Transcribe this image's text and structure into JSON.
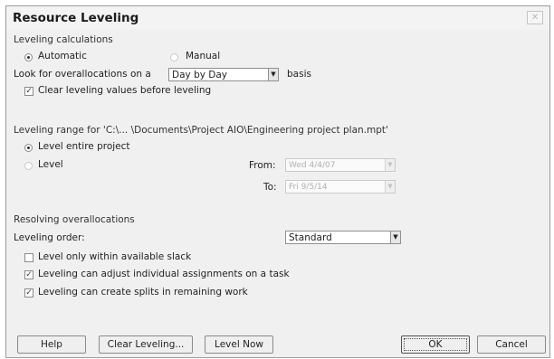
{
  "dialog": {
    "title": "Resource Leveling",
    "close_symbol": "✕"
  },
  "leveling_calculations": {
    "section_label": "Leveling calculations",
    "automatic_label": "Automatic",
    "automatic_selected": true,
    "manual_label": "Manual",
    "look_for_label": "Look for overallocations on a",
    "basis_value": "Day by Day",
    "basis_suffix": "basis",
    "clear_values_label": "Clear leveling values before leveling",
    "clear_values_checked": true
  },
  "leveling_range": {
    "section_label": "Leveling range for 'C:\\... \\Documents\\Project AIO\\Engineering project plan.mpt'",
    "level_entire_label": "Level entire project",
    "level_entire_selected": true,
    "level_label": "Level",
    "from_label": "From:",
    "from_value": "Wed 4/4/07",
    "to_label": "To:",
    "to_value": "Fri 9/5/14"
  },
  "resolving": {
    "section_label": "Resolving overallocations",
    "order_label": "Leveling order:",
    "order_value": "Standard",
    "within_slack_label": "Level only within available slack",
    "within_slack_checked": false,
    "adjust_assignments_label": "Leveling can adjust individual assignments on a task",
    "adjust_assignments_checked": true,
    "create_splits_label": "Leveling can create splits in remaining work",
    "create_splits_checked": true
  },
  "buttons": {
    "help": "Help",
    "clear_leveling": "Clear Leveling...",
    "level_now": "Level Now",
    "ok": "OK",
    "cancel": "Cancel"
  },
  "glyphs": {
    "dropdown_arrow": "▼",
    "check_mark": "✓"
  }
}
